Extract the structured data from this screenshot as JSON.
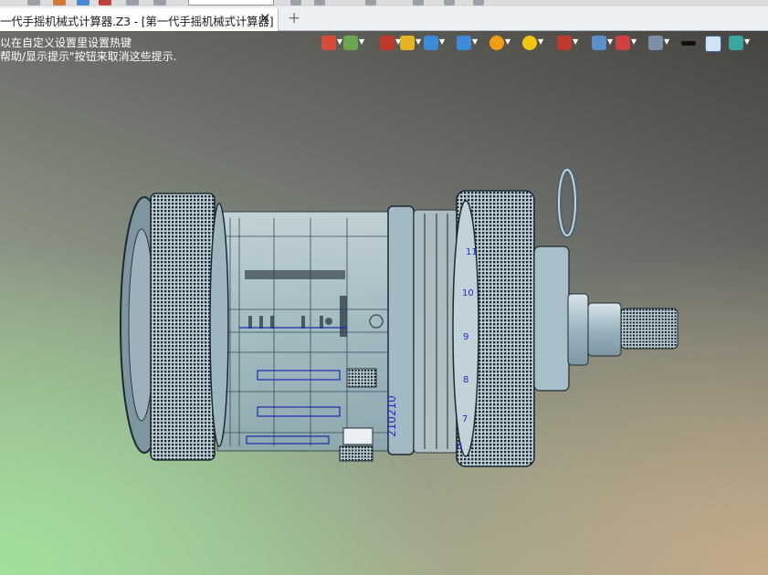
{
  "document_tab": {
    "title": "一代手摇机械式计算器.Z3 - [第一代手摇机械式计算器]",
    "close_symbol": "✕",
    "add_symbol": "+"
  },
  "viewport": {
    "hint_line_1": "以在自定义设置里设置热键",
    "hint_line_2": "帮助/显示提示\"按钮来取消这些提示."
  },
  "view_toolbar": [
    {
      "name": "exit-view-icon",
      "color": "#d94a3a"
    },
    {
      "name": "orient-icon",
      "color": "#6aa84f"
    },
    {
      "name": "pick-filter-icon",
      "color": "#c0392b"
    },
    {
      "name": "shaded-mode-icon",
      "color": "#e6b422"
    },
    {
      "name": "cube-view-icon",
      "color": "#3c8ad8"
    },
    {
      "name": "view-manager-icon",
      "color": "#3c8ad8"
    },
    {
      "name": "render-sphere-icon",
      "color": "#f39c12"
    },
    {
      "name": "zoom-lens-icon",
      "color": "#f1c40f"
    },
    {
      "name": "pin-icon",
      "color": "#c0392b"
    },
    {
      "name": "zoom-fit-icon",
      "color": "#5a8fc8"
    },
    {
      "name": "section-icon",
      "color": "#d04040"
    },
    {
      "name": "display-icon",
      "color": "#7b8fa6"
    },
    {
      "name": "line-color-icon",
      "color": "#111111"
    },
    {
      "name": "background-color-icon",
      "color": "#cfe3f5"
    },
    {
      "name": "layer-icon",
      "color": "#3aa6a0"
    }
  ],
  "dial_numbers": [
    "11",
    "10",
    "9",
    "8",
    "7",
    "6"
  ],
  "counter_digits": "210210"
}
